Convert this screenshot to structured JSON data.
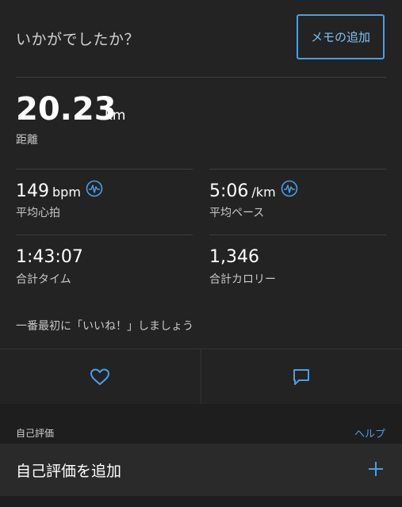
{
  "header": {
    "question": "いかがでしたか？",
    "memo_button": "メモの追加"
  },
  "distance": {
    "value": "20.23",
    "unit": "km",
    "label": "距離"
  },
  "stats": {
    "heart_rate": {
      "value": "149",
      "unit": "bpm",
      "label": "平均心拍"
    },
    "pace": {
      "value": "5:06",
      "unit": "/km",
      "label": "平均ペース"
    },
    "time": {
      "value": "1:43:07",
      "label": "合計タイム"
    },
    "calories": {
      "value": "1,346",
      "label": "合計カロリー"
    }
  },
  "social": {
    "first_like_text": "一番最初に「いいね！」しましょう"
  },
  "self_evaluation": {
    "section_title": "自己評価",
    "help_link": "ヘルプ",
    "add_label": "自己評価を追加"
  },
  "colors": {
    "accent": "#4a9ee6",
    "background": "#1e1e1e",
    "card": "#232323"
  }
}
